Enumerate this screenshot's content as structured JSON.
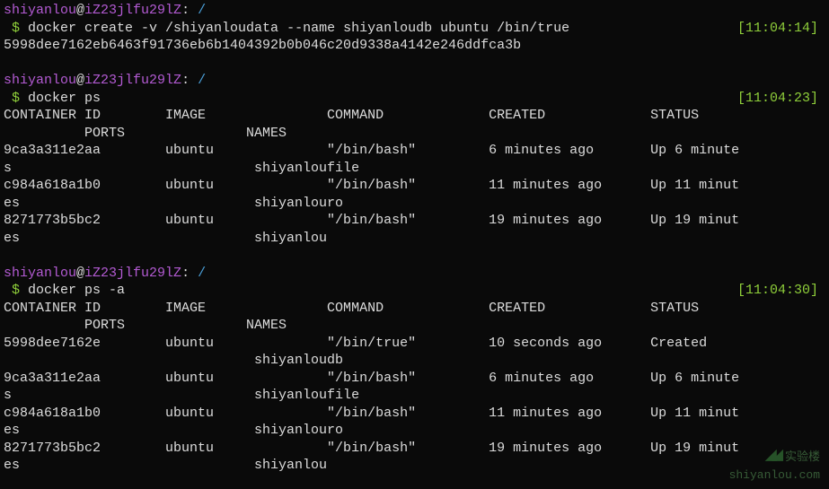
{
  "prompt": {
    "user": "shiyanlou",
    "at": "@",
    "host": "iZ23jlfu29lZ",
    "colon": ":",
    "path": " /",
    "sym": " $ "
  },
  "blocks": [
    {
      "cmd": "docker create -v /shiyanloudata --name shiyanloudb ubuntu /bin/true",
      "ts": "[11:04:14]",
      "out": [
        "5998dee7162eb6463f91736eb6b1404392b0b046c20d9338a4142e246ddfca3b"
      ]
    },
    {
      "cmd": "docker ps",
      "ts": "[11:04:23]",
      "out": [
        "CONTAINER ID        IMAGE               COMMAND             CREATED             STATUS    ",
        "          PORTS               NAMES",
        "9ca3a311e2aa        ubuntu              \"/bin/bash\"         6 minutes ago       Up 6 minute",
        "s                              shiyanloufile",
        "c984a618a1b0        ubuntu              \"/bin/bash\"         11 minutes ago      Up 11 minut",
        "es                             shiyanlouro",
        "8271773b5bc2        ubuntu              \"/bin/bash\"         19 minutes ago      Up 19 minut",
        "es                             shiyanlou"
      ]
    },
    {
      "cmd": "docker ps -a",
      "ts": "[11:04:30]",
      "out": [
        "CONTAINER ID        IMAGE               COMMAND             CREATED             STATUS    ",
        "          PORTS               NAMES",
        "5998dee7162e        ubuntu              \"/bin/true\"         10 seconds ago      Created   ",
        "                               shiyanloudb",
        "9ca3a311e2aa        ubuntu              \"/bin/bash\"         6 minutes ago       Up 6 minute",
        "s                              shiyanloufile",
        "c984a618a1b0        ubuntu              \"/bin/bash\"         11 minutes ago      Up 11 minut",
        "es                             shiyanlouro",
        "8271773b5bc2        ubuntu              \"/bin/bash\"         19 minutes ago      Up 19 minut",
        "es                             shiyanlou"
      ]
    }
  ],
  "watermark": {
    "text": "实验楼",
    "url": "shiyanlou.com"
  }
}
